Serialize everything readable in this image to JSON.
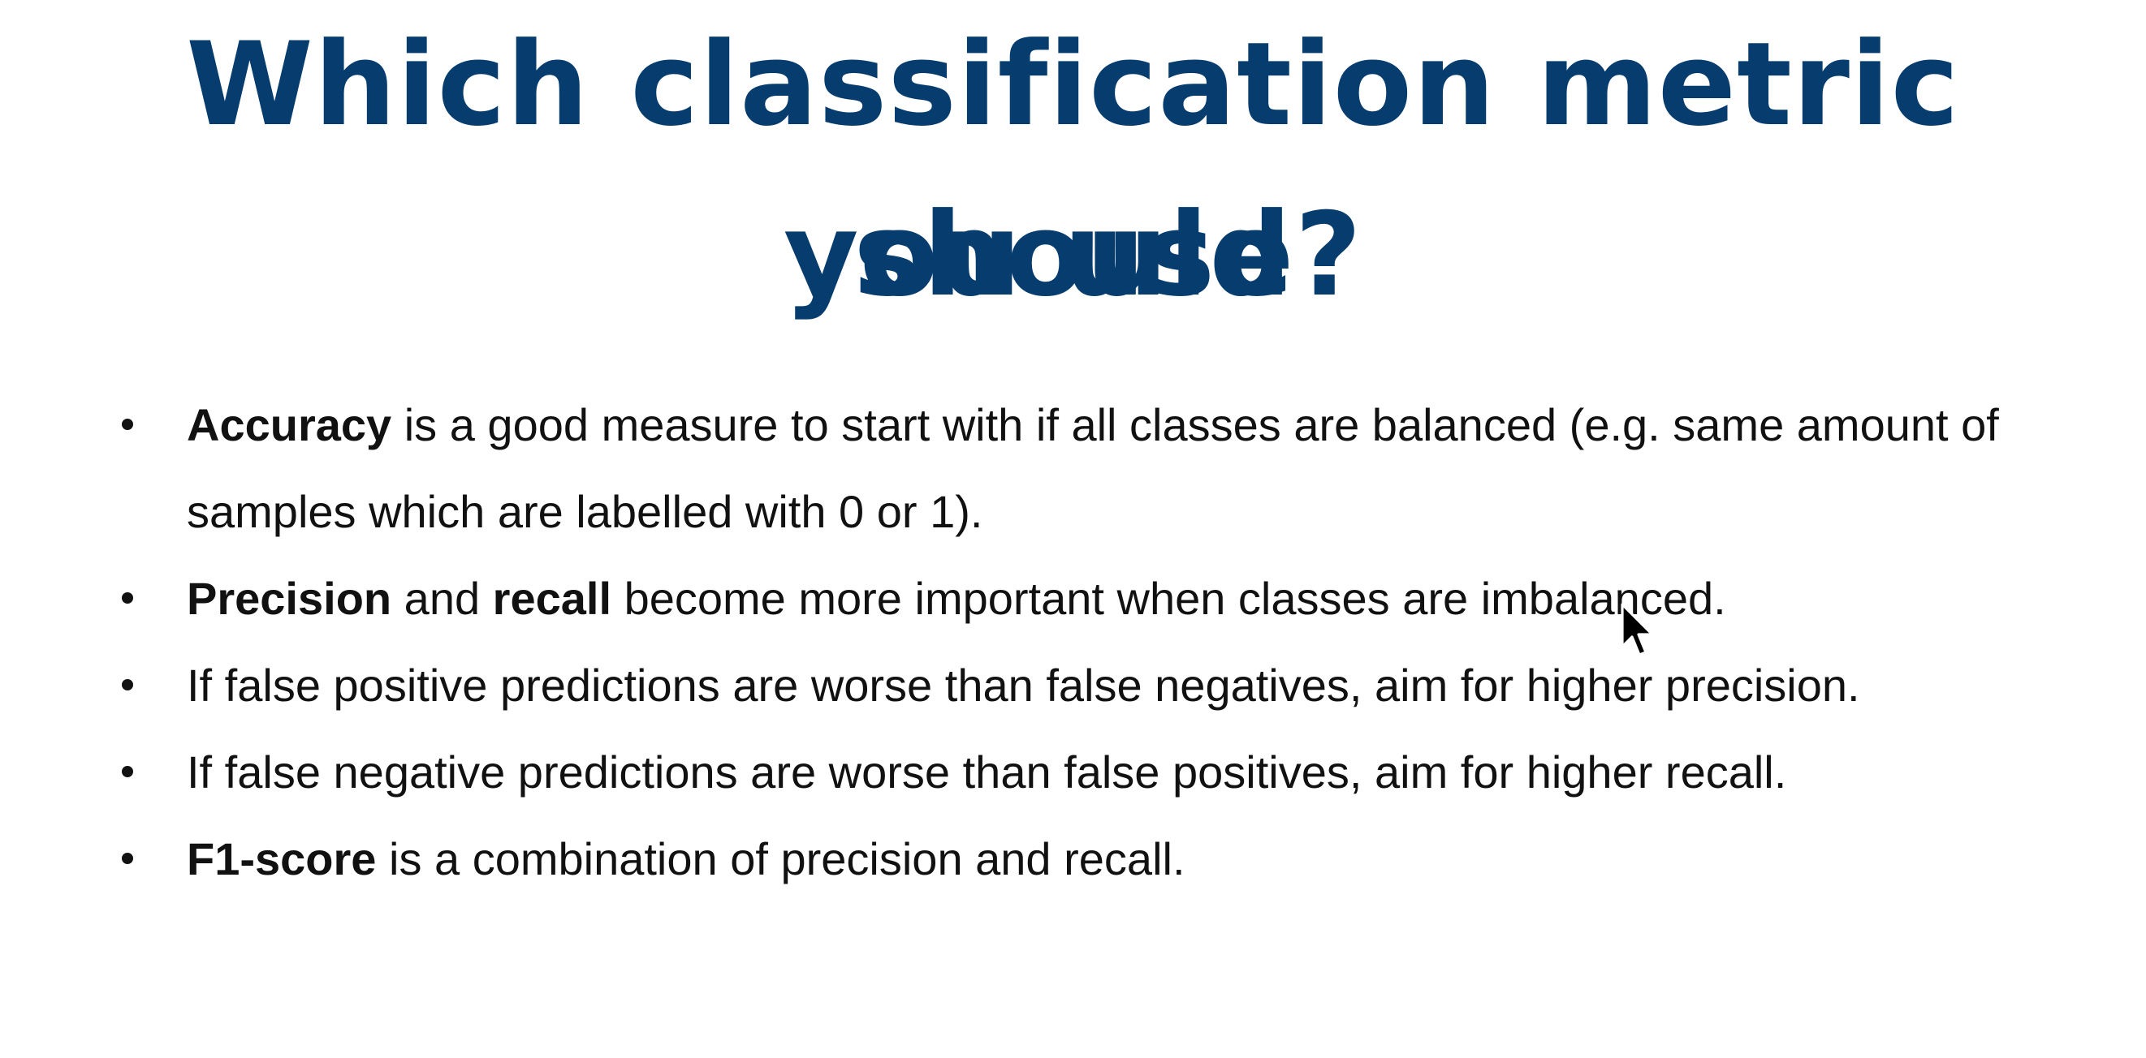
{
  "title": {
    "line1": "Which classification metric should",
    "line2": "you use?"
  },
  "bullets": [
    {
      "bold1": "Accuracy",
      "text1": " is a good measure to start with if all classes are balanced (e.g. same amount of samples which are labelled with 0 or 1)."
    },
    {
      "bold1": "Precision",
      "text1": " and ",
      "bold2": "recall",
      "text2": " become more important when classes are imbalanced."
    },
    {
      "text1": "If false positive predictions are worse than false negatives, aim for higher precision."
    },
    {
      "text1": "If false negative predictions are worse than false positives, aim for higher recall."
    },
    {
      "bold1": "F1-score",
      "text1": " is a combination of precision and recall."
    }
  ],
  "colors": {
    "title": "#063d6e",
    "body_text": "#111111",
    "background": "#ffffff"
  },
  "icons": {
    "pointer": "mouse-pointer-icon",
    "bullet": "bullet-dot-icon"
  }
}
